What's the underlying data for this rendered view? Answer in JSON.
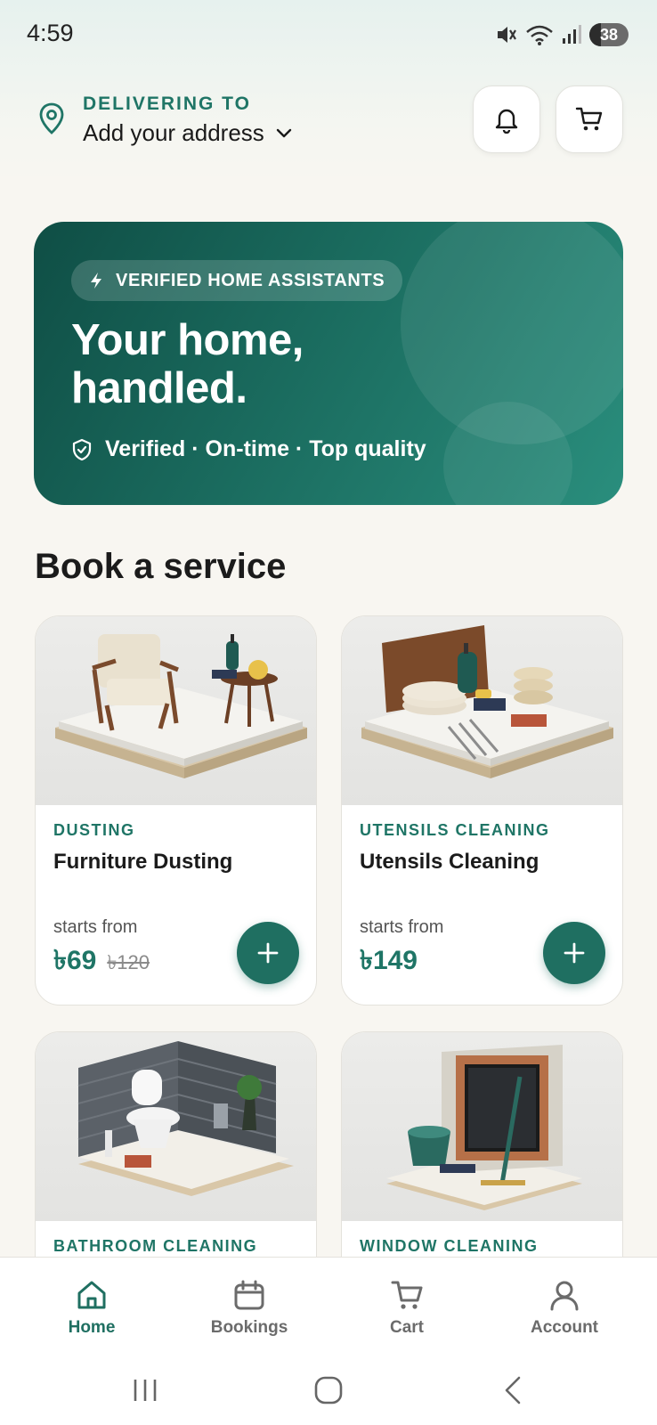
{
  "status_bar": {
    "time": "4:59",
    "battery": "38"
  },
  "header": {
    "delivering_label": "DELIVERING TO",
    "address_text": "Add your address"
  },
  "hero": {
    "badge": "VERIFIED HOME ASSISTANTS",
    "title_line1": "Your home,",
    "title_line2": "handled.",
    "subtitle": "Verified · On-time · Top quality"
  },
  "section_title": "Book a service",
  "services": [
    {
      "category": "DUSTING",
      "name": "Furniture Dusting",
      "starts_from": "starts from",
      "price": "৳69",
      "old_price": "৳120"
    },
    {
      "category": "UTENSILS CLEANING",
      "name": "Utensils Cleaning",
      "starts_from": "starts from",
      "price": "৳149",
      "old_price": ""
    },
    {
      "category": "BATHROOM CLEANING"
    },
    {
      "category": "WINDOW CLEANING"
    }
  ],
  "bottom_nav": [
    {
      "label": "Home",
      "icon": "home-icon",
      "active": true
    },
    {
      "label": "Bookings",
      "icon": "calendar-icon",
      "active": false
    },
    {
      "label": "Cart",
      "icon": "cart-icon",
      "active": false
    },
    {
      "label": "Account",
      "icon": "user-icon",
      "active": false
    }
  ],
  "colors": {
    "accent": "#1f6f61",
    "hero_dark": "#0f4e45",
    "hero_light": "#2a8e7d",
    "background": "#f8f6f1"
  }
}
